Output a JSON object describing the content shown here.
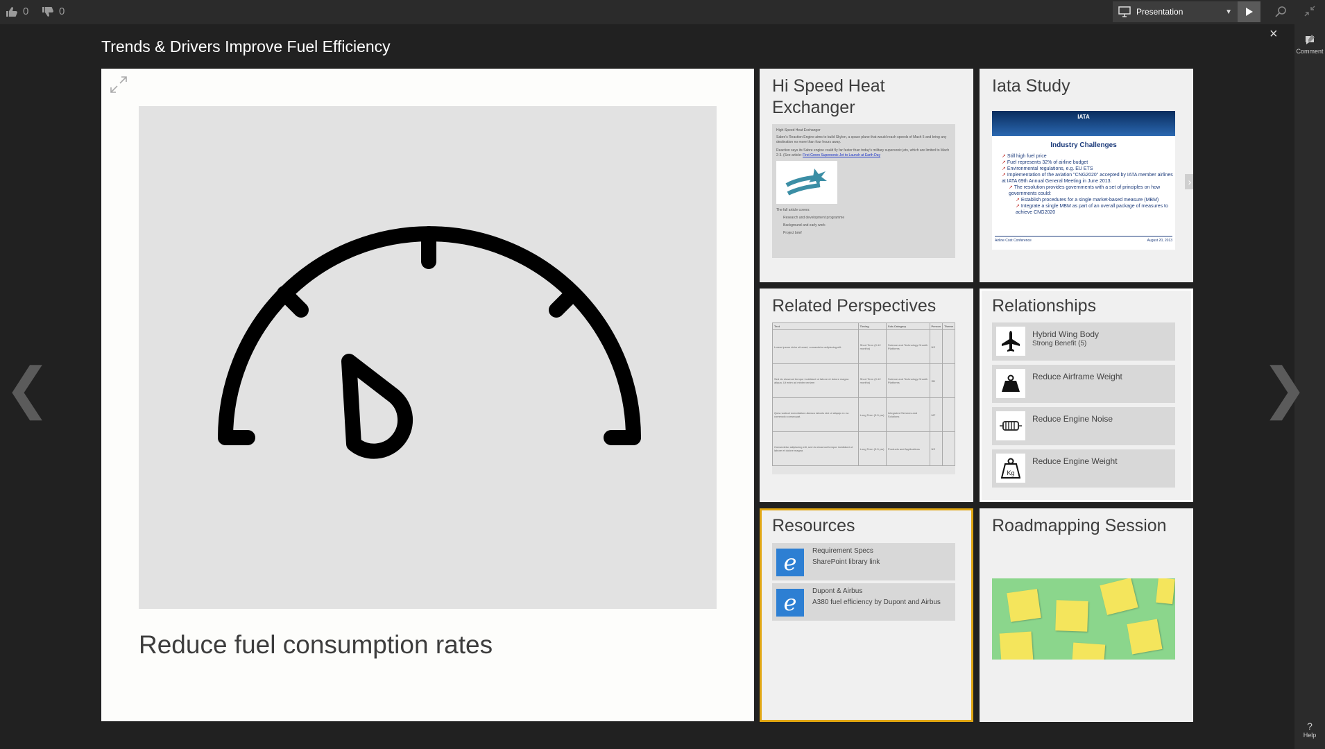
{
  "toolbar": {
    "likes": "0",
    "dislikes": "0",
    "mode": "Presentation"
  },
  "rail": {
    "comment": "Comment",
    "help": "Help"
  },
  "board_title": "Trends & Drivers Improve Fuel Efficiency",
  "main_card": {
    "caption": "Reduce fuel consumption rates",
    "icon": "speedometer-icon"
  },
  "tiles": {
    "heat_exchanger": {
      "title": "Hi Speed Heat Exchanger",
      "doc_heading": "High-Speed Heat Exchanger",
      "doc_p1": "Sabre's Reaction Engine aims to build Skylon, a space plane that would reach speeds of Mach 5 and bring any destination no more than four hours away.",
      "doc_p2": "Reaction says its Sabre engine could fly far faster than today's military supersonic jets, which are limited to Mach 2-3. (See article:",
      "doc_link": "First Green Supersonic Jet to Launch at Earth Day",
      "doc_p3": "The full article covers:",
      "doc_bullets": [
        "Research and development programme",
        "Background and early work",
        "Project brief"
      ]
    },
    "iata": {
      "title": "Iata Study",
      "logo": "IATA",
      "slide_heading": "Industry Challenges",
      "bullets": [
        "Still high fuel price",
        "Fuel represents 32% of airline budget",
        "Environmental regulations, e.g. EU ETS",
        "Implementation of the aviation \"CNG2020\" accepted by IATA member airlines at IATA 69th Annual General Meeting in June 2013:",
        "The resolution provides governments with a set of principles on how governments could:",
        "Establish procedures for a single market-based measure (MBM)",
        "Integrate a single MBM as part of an overall package of measures to achieve CNG2020"
      ],
      "footer_left": "Airline Cost Conference",
      "footer_right": "August 20, 2013"
    },
    "perspectives": {
      "title": "Related Perspectives",
      "columns": [
        "Text",
        "Timing",
        "Sub-Category",
        "Person",
        "Theme"
      ],
      "rows": [
        [
          "Lorem ipsum dolor sit amet, consectetur adipiscing elit.",
          "Short Term (0-12 months)",
          "Science and Technology Growth Platforms",
          "NS",
          ""
        ],
        [
          "Sed do eiusmod tempor incididunt ut labore et dolore magna aliqua. Ut enim ad minim veniam",
          "Short Term (0-12 months)",
          "Science and Technology Growth Platforms",
          "SB",
          ""
        ],
        [
          "Quis nostrud exercitation ullamco laboris nisi ut aliquip ex ea commodo consequat.",
          "Long Term (3-5 yrs)",
          "Integrated Services and Solutions",
          "MF",
          ""
        ],
        [
          "Consectetur adipiscing elit, sed do eiusmod tempor incididunt ut labore et dolore magna",
          "Long Term (3-5 yrs)",
          "Products and Applications",
          "NS",
          ""
        ]
      ]
    },
    "relationships": {
      "title": "Relationships",
      "items": [
        {
          "label": "Hybrid Wing Body",
          "sub": "Strong Benefit (5)",
          "icon": "airplane-icon"
        },
        {
          "label": "Reduce Airframe Weight",
          "sub": "",
          "icon": "weight-icon"
        },
        {
          "label": "Reduce Engine Noise",
          "sub": "",
          "icon": "engine-icon"
        },
        {
          "label": "Reduce Engine Weight",
          "sub": "",
          "icon": "kg-weight-icon"
        }
      ]
    },
    "resources": {
      "title": "Resources",
      "items": [
        {
          "title": "Requirement Specs",
          "desc": "SharePoint library link"
        },
        {
          "title": "Dupont & Airbus",
          "desc": "A380 fuel efficiency by Dupont and Airbus"
        }
      ]
    },
    "roadmapping": {
      "title": "Roadmapping Session"
    }
  },
  "colors": {
    "background": "#212121",
    "card": "#fdfdfb",
    "tile": "#f0f0f0",
    "selected_border": "#e0a613",
    "ie_blue": "#2d7fd3",
    "sticky_yellow": "#f4e55c",
    "board_green": "#8bd68c"
  }
}
